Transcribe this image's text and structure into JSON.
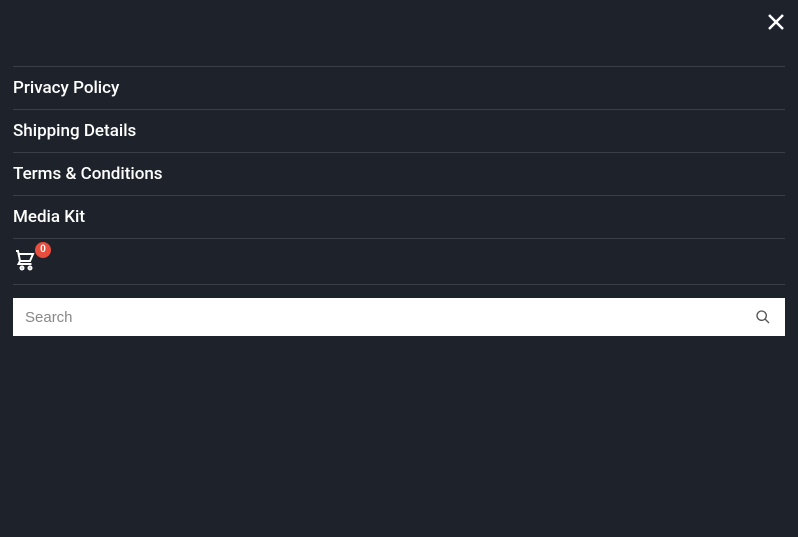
{
  "menu": {
    "items": [
      {
        "label": "Privacy Policy"
      },
      {
        "label": "Shipping Details"
      },
      {
        "label": "Terms & Conditions"
      },
      {
        "label": "Media Kit"
      }
    ]
  },
  "cart": {
    "count": "0"
  },
  "search": {
    "placeholder": "Search"
  }
}
